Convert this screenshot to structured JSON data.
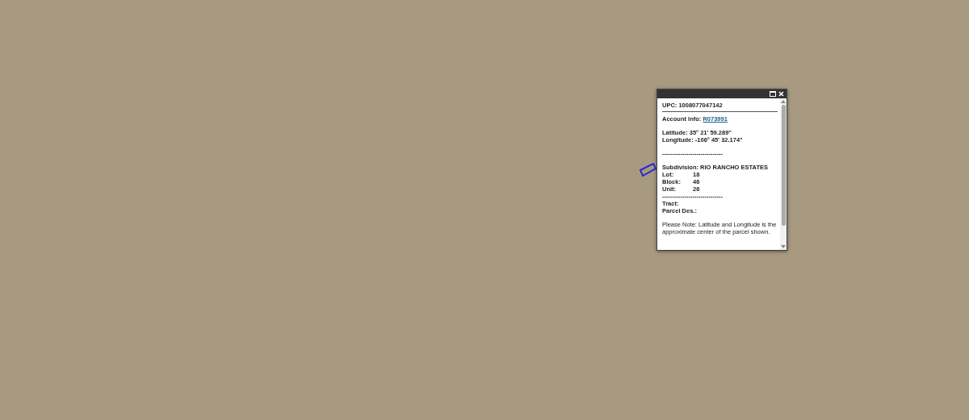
{
  "map": {
    "popup": {
      "upc": "UPC: 1008077047142",
      "account_label": "Account Info:",
      "account_link": "R073991",
      "latitude": "Latitude: 35° 21' 59.289\"",
      "longitude": "Longitude: -106° 45' 32.174\"",
      "separator_1": "------------------------------",
      "subdivision": "Subdivision: RIO RANCHO ESTATES",
      "fields": [
        {
          "label": "Lot:",
          "value": "18"
        },
        {
          "label": "Block:",
          "value": "46"
        },
        {
          "label": "Unit:",
          "value": "26"
        }
      ],
      "separator_2": "------------------------------",
      "extra_fields": [
        "Tract:",
        "Parcel Des.:"
      ],
      "note": "Please Note: Latitude and Longitude is the approximate center of the parcel shown."
    }
  }
}
